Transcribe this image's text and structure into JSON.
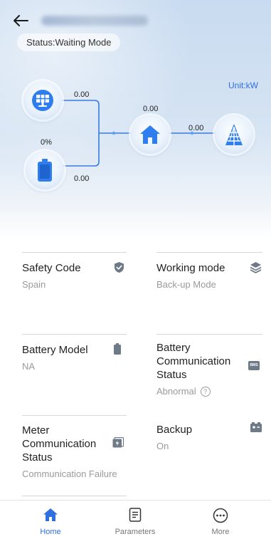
{
  "header": {
    "status_text": "Status:Waiting Mode"
  },
  "flow": {
    "unit": "Unit:kW",
    "pv_power": "0.00",
    "battery_soc": "0%",
    "battery_power": "0.00",
    "load_power": "0.00",
    "grid_power": "0.00"
  },
  "cards": [
    {
      "title": "Safety Code",
      "value": "Spain",
      "icon": "shield-check-icon"
    },
    {
      "title": "Working mode",
      "value": "Back-up Mode",
      "icon": "layers-icon"
    },
    {
      "title": "Battery Model",
      "value": "NA",
      "icon": "battery-icon"
    },
    {
      "title": "Battery Communication Status",
      "value": "Abnormal",
      "icon": "bms-icon"
    },
    {
      "title": "Meter Communication Status",
      "value": "Communication Failure",
      "icon": "meter-icon"
    },
    {
      "title": "Backup",
      "value": "On",
      "icon": "backup-battery-icon"
    }
  ],
  "bms_badge": "BMS",
  "help_glyph": "?",
  "tabs": [
    {
      "label": "Home",
      "icon": "home-icon",
      "active": true
    },
    {
      "label": "Parameters",
      "icon": "document-icon",
      "active": false
    },
    {
      "label": "More",
      "icon": "more-icon",
      "active": false
    }
  ],
  "colors": {
    "accent": "#2f6fe0",
    "flow_line": "#3a7be0",
    "card_icon": "#6e7a88"
  }
}
